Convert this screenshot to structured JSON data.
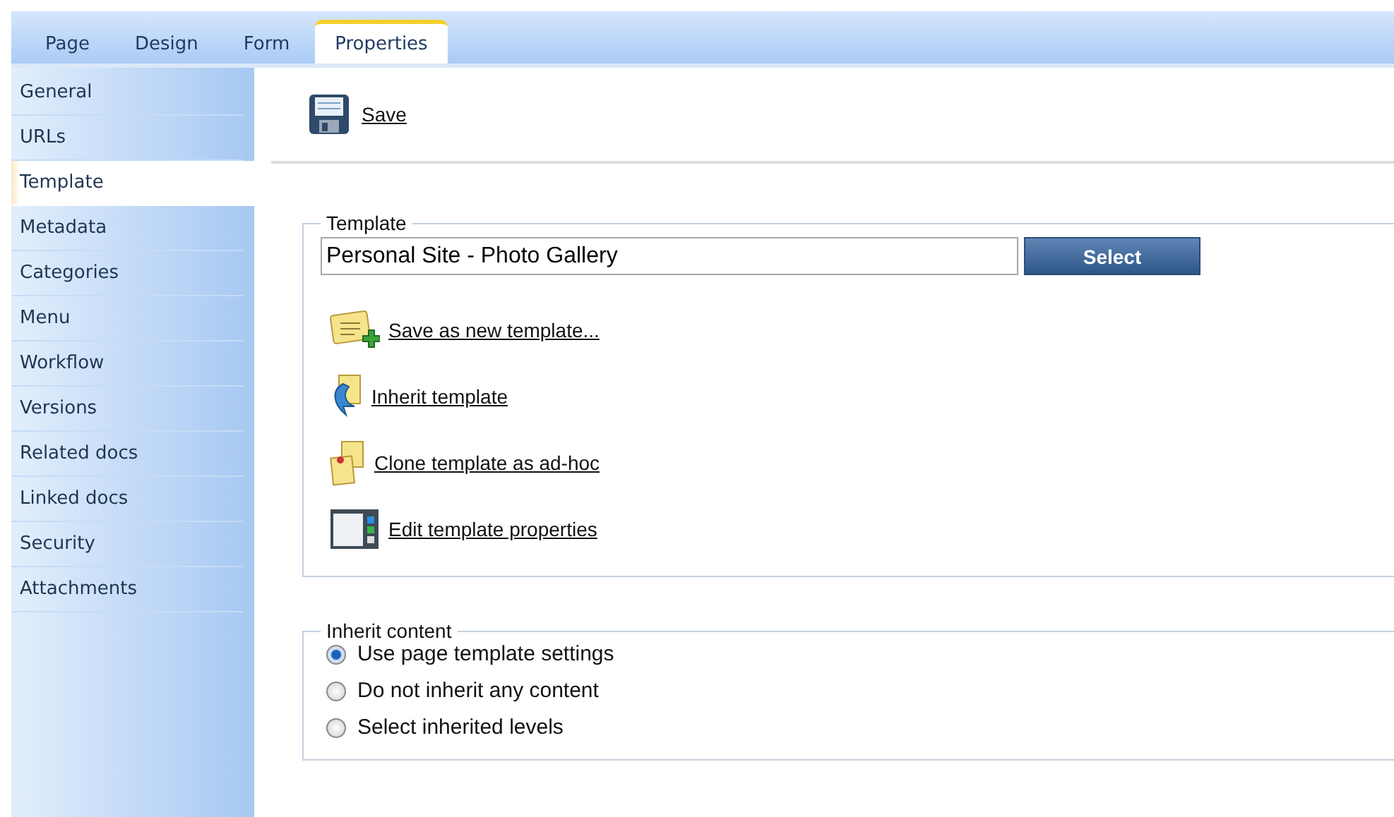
{
  "tabs": [
    {
      "label": "Page",
      "selected": false
    },
    {
      "label": "Design",
      "selected": false
    },
    {
      "label": "Form",
      "selected": false
    },
    {
      "label": "Properties",
      "selected": true
    }
  ],
  "sidebar": {
    "items": [
      {
        "label": "General",
        "selected": false
      },
      {
        "label": "URLs",
        "selected": false
      },
      {
        "label": "Template",
        "selected": true
      },
      {
        "label": "Metadata",
        "selected": false
      },
      {
        "label": "Categories",
        "selected": false
      },
      {
        "label": "Menu",
        "selected": false
      },
      {
        "label": "Workflow",
        "selected": false
      },
      {
        "label": "Versions",
        "selected": false
      },
      {
        "label": "Related docs",
        "selected": false
      },
      {
        "label": "Linked docs",
        "selected": false
      },
      {
        "label": "Security",
        "selected": false
      },
      {
        "label": "Attachments",
        "selected": false
      }
    ]
  },
  "toolbar": {
    "save": "Save"
  },
  "template": {
    "legend": "Template",
    "value": "Personal Site - Photo Gallery",
    "select_button": "Select",
    "actions": [
      {
        "kind": "new",
        "label": "Save as new template..."
      },
      {
        "kind": "inherit",
        "label": "Inherit template"
      },
      {
        "kind": "clone",
        "label": "Clone template as ad-hoc"
      },
      {
        "kind": "properties",
        "label": "Edit template properties"
      }
    ]
  },
  "inherit_content": {
    "legend": "Inherit content",
    "options": [
      {
        "label": "Use page template settings",
        "selected": true
      },
      {
        "label": "Do not inherit any content",
        "selected": false
      },
      {
        "label": "Select inherited levels",
        "selected": false
      }
    ]
  }
}
